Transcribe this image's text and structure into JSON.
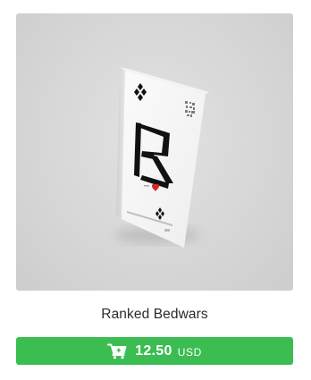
{
  "product": {
    "title": "Ranked Bedwars",
    "price": "12.50",
    "currency": "USD",
    "image_icon": "ranked-bedwars-card-box",
    "buy_icon": "cart-plus-icon"
  },
  "colors": {
    "button": "#3bbd52",
    "image_background": "#d7d7d7"
  }
}
